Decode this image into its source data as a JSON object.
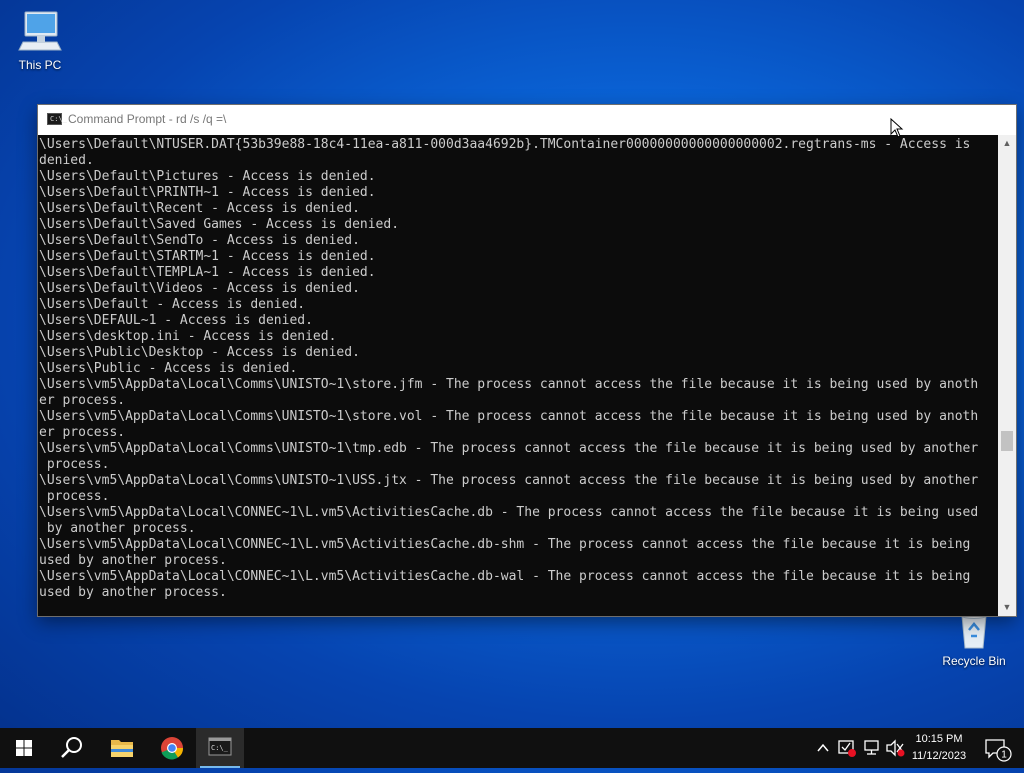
{
  "desktop": {
    "this_pc_label": "This PC",
    "recycle_bin_label": "Recycle Bin"
  },
  "window": {
    "title": "Command Prompt - rd  /s /q =\\",
    "console_lines": [
      "\\Users\\Default\\NTUSER.DAT{53b39e88-18c4-11ea-a811-000d3aa4692b}.TMContainer00000000000000000002.regtrans-ms - Access is",
      "denied.",
      "\\Users\\Default\\Pictures - Access is denied.",
      "\\Users\\Default\\PRINTH~1 - Access is denied.",
      "\\Users\\Default\\Recent - Access is denied.",
      "\\Users\\Default\\Saved Games - Access is denied.",
      "\\Users\\Default\\SendTo - Access is denied.",
      "\\Users\\Default\\STARTM~1 - Access is denied.",
      "\\Users\\Default\\TEMPLA~1 - Access is denied.",
      "\\Users\\Default\\Videos - Access is denied.",
      "\\Users\\Default - Access is denied.",
      "\\Users\\DEFAUL~1 - Access is denied.",
      "\\Users\\desktop.ini - Access is denied.",
      "\\Users\\Public\\Desktop - Access is denied.",
      "\\Users\\Public - Access is denied.",
      "\\Users\\vm5\\AppData\\Local\\Comms\\UNISTO~1\\store.jfm - The process cannot access the file because it is being used by anoth",
      "er process.",
      "\\Users\\vm5\\AppData\\Local\\Comms\\UNISTO~1\\store.vol - The process cannot access the file because it is being used by anoth",
      "er process.",
      "\\Users\\vm5\\AppData\\Local\\Comms\\UNISTO~1\\tmp.edb - The process cannot access the file because it is being used by another",
      " process.",
      "\\Users\\vm5\\AppData\\Local\\Comms\\UNISTO~1\\USS.jtx - The process cannot access the file because it is being used by another",
      " process.",
      "\\Users\\vm5\\AppData\\Local\\CONNEC~1\\L.vm5\\ActivitiesCache.db - The process cannot access the file because it is being used",
      " by another process.",
      "\\Users\\vm5\\AppData\\Local\\CONNEC~1\\L.vm5\\ActivitiesCache.db-shm - The process cannot access the file because it is being",
      "used by another process.",
      "\\Users\\vm5\\AppData\\Local\\CONNEC~1\\L.vm5\\ActivitiesCache.db-wal - The process cannot access the file because it is being",
      "used by another process."
    ]
  },
  "taskbar": {
    "time": "10:15 PM",
    "date": "11/12/2023",
    "notification_count": "1",
    "pinned_icons": [
      "start-icon",
      "search-icon",
      "file-explorer-icon",
      "chrome-icon",
      "command-prompt-icon"
    ],
    "tray_icons": [
      "chevron-up-icon",
      "security-icon",
      "network-icon",
      "volume-muted-icon",
      "notification-icon"
    ]
  },
  "colors": {
    "desktop_blue": "#0a63d6",
    "console_bg": "#0c0c0c",
    "console_text": "#cccccc",
    "taskbar_bg": "#101010",
    "active_indicator": "#76b9ed"
  }
}
